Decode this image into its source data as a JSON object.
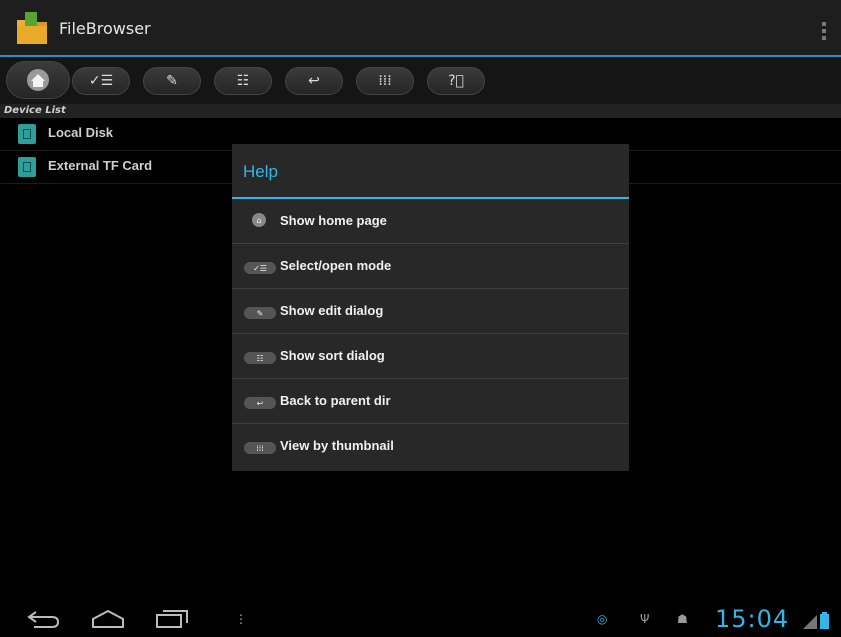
{
  "app": {
    "title": "FileBrowser"
  },
  "toolbar": {
    "buttons": [
      {
        "name": "home",
        "icon": "home-icon"
      },
      {
        "name": "select",
        "icon": "select-list-icon"
      },
      {
        "name": "edit",
        "icon": "edit-icon"
      },
      {
        "name": "sort",
        "icon": "sort-icon"
      },
      {
        "name": "back",
        "icon": "back-arrow-icon"
      },
      {
        "name": "thumbnail",
        "icon": "grid-icon"
      },
      {
        "name": "help",
        "icon": "help-icon"
      }
    ]
  },
  "device_list": {
    "header": "Device List",
    "items": [
      {
        "label": "Local Disk",
        "icon": "sd-card-icon"
      },
      {
        "label": "External TF Card",
        "icon": "sd-card-icon"
      }
    ]
  },
  "help_dialog": {
    "title": "Help",
    "items": [
      {
        "label": "Show home page",
        "icon": "home-icon"
      },
      {
        "label": "Select/open mode",
        "icon": "select-list-icon"
      },
      {
        "label": "Show edit dialog",
        "icon": "edit-icon"
      },
      {
        "label": "Show sort dialog",
        "icon": "sort-icon"
      },
      {
        "label": "Back to parent dir",
        "icon": "back-arrow-icon"
      },
      {
        "label": "View by thumbnail",
        "icon": "grid-icon"
      }
    ]
  },
  "status_bar": {
    "time": "15:04"
  },
  "colors": {
    "accent": "#33b5e5",
    "background": "#000000",
    "dialog": "#282828"
  }
}
